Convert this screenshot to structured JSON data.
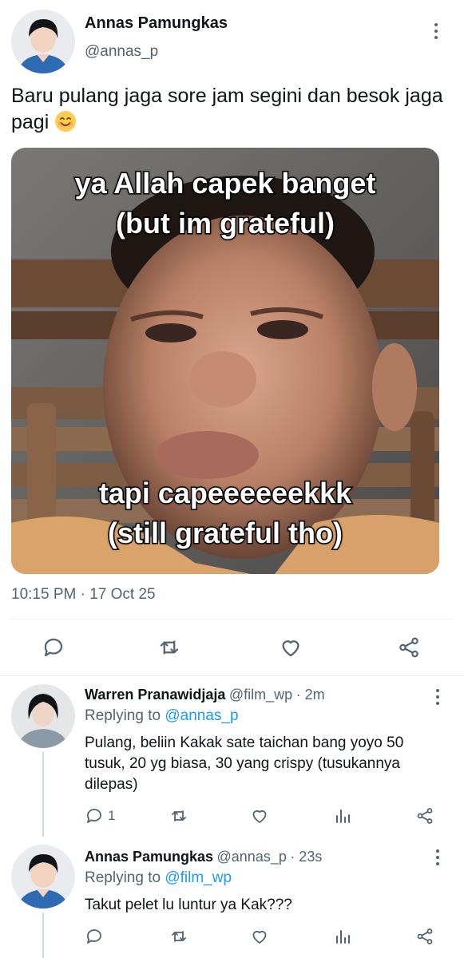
{
  "main_tweet": {
    "author_name": "Annas Pamungkas",
    "author_handle": "@annas_p",
    "text": "Baru pulang jaga sore jam segini dan besok jaga pagi",
    "emoji_icon": "smiling-face-emoji",
    "meme": {
      "top_line1": "ya Allah capek banget",
      "top_line2": "(but im grateful)",
      "bottom_line1": "tapi capeeeeeekkk",
      "bottom_line2": "(still grateful tho)"
    },
    "timestamp": "10:15 PM · 17 Oct 25",
    "actions": [
      "reply-icon",
      "retweet-icon",
      "like-icon",
      "share-icon"
    ]
  },
  "replies": [
    {
      "author_name": "Warren Pranawidjaja",
      "author_handle": "@film_wp",
      "time": "· 2m",
      "replying_prefix": "Replying to",
      "replying_to": "@annas_p",
      "text_line1": "Pulang, beliin Kakak sate taichan bang yoyo 50",
      "text_line2": "tusuk, 20 yg biasa, 30 yang crispy (tusukannya",
      "text_line3": "dilepas)",
      "reply_count": "1"
    },
    {
      "author_name": "Annas Pamungkas",
      "author_handle": "@annas_p",
      "time": "· 23s",
      "replying_prefix": "Replying to",
      "replying_to": "@film_wp",
      "text_line1": "Takut pelet lu luntur ya Kak???",
      "reply_count": ""
    }
  ],
  "colors": {
    "text_primary": "#0f1419",
    "text_secondary": "#536471",
    "link": "#1d9bf0",
    "divider": "#eff3f4"
  }
}
